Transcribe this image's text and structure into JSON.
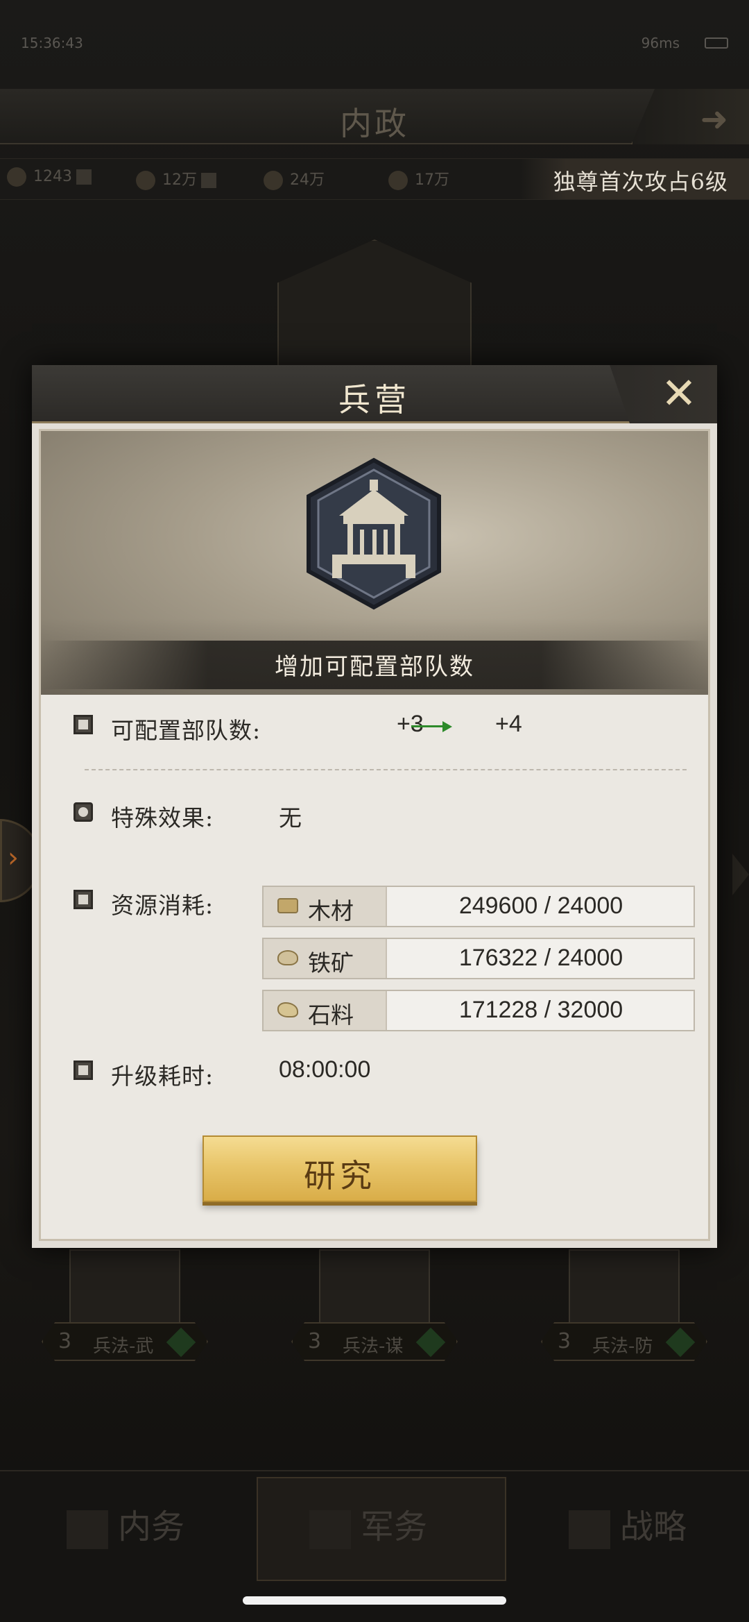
{
  "status_bar": {
    "time": "15:36:43",
    "network": "96ms"
  },
  "background": {
    "page_title": "内政",
    "resources": [
      {
        "value": "1243"
      },
      {
        "value": "12万"
      },
      {
        "value": "24万"
      },
      {
        "value": "17万"
      }
    ],
    "notice": "独尊首次攻占6级",
    "skills": [
      {
        "level": "3",
        "name": "兵法-武"
      },
      {
        "level": "3",
        "name": "兵法-谋"
      },
      {
        "level": "3",
        "name": "兵法-防"
      }
    ],
    "bottom_nav": [
      {
        "label": "内务"
      },
      {
        "label": "军务"
      },
      {
        "label": "战略"
      }
    ]
  },
  "modal": {
    "title": "兵营",
    "banner_caption": "增加可配置部队数",
    "troop_row": {
      "label": "可配置部队数:",
      "from": "+3",
      "to": "+4"
    },
    "special_row": {
      "label": "特殊效果:",
      "value": "无"
    },
    "resource_row": {
      "label": "资源消耗:",
      "items": [
        {
          "name": "木材",
          "owned": "249600",
          "required": "24000",
          "icon": "wood-icon"
        },
        {
          "name": "铁矿",
          "owned": "176322",
          "required": "24000",
          "icon": "iron-icon"
        },
        {
          "name": "石料",
          "owned": "171228",
          "required": "32000",
          "icon": "stone-icon"
        }
      ],
      "separator": "/"
    },
    "time_row": {
      "label": "升级耗时:",
      "value": "08:00:00"
    },
    "research_button": "研究"
  },
  "colors": {
    "accent_gold": "#e8c56a",
    "increase_arrow": "#2d8a2a",
    "header_dark": "#2c2a27"
  }
}
